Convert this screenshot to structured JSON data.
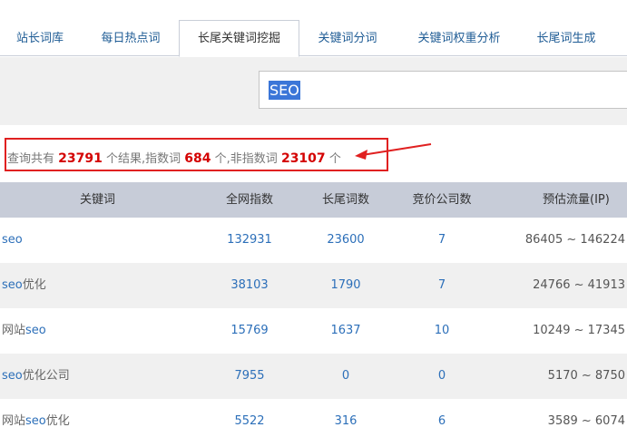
{
  "tabs": [
    {
      "label": "站长词库",
      "active": false
    },
    {
      "label": "每日热点词",
      "active": false
    },
    {
      "label": "长尾关键词挖掘",
      "active": true
    },
    {
      "label": "关键词分词",
      "active": false
    },
    {
      "label": "关键词权重分析",
      "active": false
    },
    {
      "label": "长尾词生成",
      "active": false
    }
  ],
  "search": {
    "value": "SEO"
  },
  "summary": {
    "prefix": "查询共有",
    "total": "23791",
    "mid1": "个结果,指数词",
    "indexed": "684",
    "mid2": "个,非指数词",
    "non_indexed": "23107",
    "suffix": "个"
  },
  "annotation": {
    "box_color": "#e02020",
    "arrow_color": "#e02020"
  },
  "colors": {
    "link": "#2c6fb9",
    "header_bg": "#c7ccd8",
    "alt_row_bg": "#f0f0f0",
    "highlight_number": "#d40000"
  },
  "table": {
    "headers": [
      "关键词",
      "全网指数",
      "长尾词数",
      "竞价公司数",
      "预估流量(IP)"
    ],
    "rows": [
      {
        "kw_pre": "",
        "kw_seo": "seo",
        "kw_post": "",
        "index": "132931",
        "longtail": "23600",
        "bidders": "7",
        "traffic": "86405 ~ 146224"
      },
      {
        "kw_pre": "",
        "kw_seo": "seo",
        "kw_post": "优化",
        "index": "38103",
        "longtail": "1790",
        "bidders": "7",
        "traffic": "24766 ~ 41913"
      },
      {
        "kw_pre": "网站",
        "kw_seo": "seo",
        "kw_post": "",
        "index": "15769",
        "longtail": "1637",
        "bidders": "10",
        "traffic": "10249 ~ 17345"
      },
      {
        "kw_pre": "",
        "kw_seo": "seo",
        "kw_post": "优化公司",
        "index": "7955",
        "longtail": "0",
        "bidders": "0",
        "traffic": "5170 ~ 8750"
      },
      {
        "kw_pre": "网站",
        "kw_seo": "seo",
        "kw_post": "优化",
        "index": "5522",
        "longtail": "316",
        "bidders": "6",
        "traffic": "3589 ~ 6074"
      }
    ]
  }
}
